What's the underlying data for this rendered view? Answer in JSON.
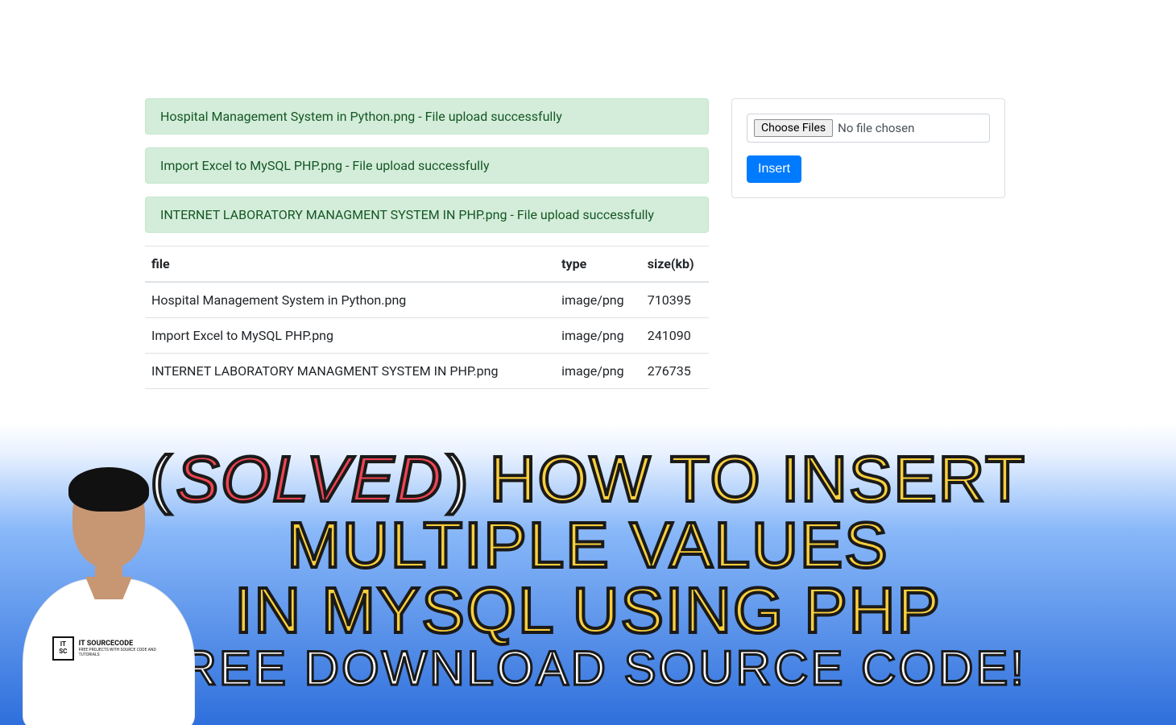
{
  "alerts": [
    "Hospital Management System in Python.png - File upload successfully",
    "Import Excel to MySQL PHP.png - File upload successfully",
    "INTERNET LABORATORY MANAGMENT SYSTEM IN PHP.png - File upload successfully"
  ],
  "table": {
    "headers": {
      "file": "file",
      "type": "type",
      "size": "size(kb)"
    },
    "rows": [
      {
        "file": "Hospital Management System in Python.png",
        "type": "image/png",
        "size": "710395"
      },
      {
        "file": "Import Excel to MySQL PHP.png",
        "type": "image/png",
        "size": "241090"
      },
      {
        "file": "INTERNET LABORATORY MANAGMENT SYSTEM IN PHP.png",
        "type": "image/png",
        "size": "276735"
      }
    ]
  },
  "upload": {
    "choose_label": "Choose Files",
    "status": "No file chosen",
    "submit_label": "Insert"
  },
  "banner": {
    "line1_paren_open": "(",
    "line1_solved": "SOLVED",
    "line1_paren_close": ")",
    "line1_rest": " HOW TO INSERT",
    "line2": "MULTIPLE VALUES",
    "line3": "IN MYSQL USING PHP",
    "line4": "FREE DOWNLOAD SOURCE CODE!"
  },
  "shirt_logo": {
    "box_top": "IT",
    "box_bottom": "SC",
    "main": "IT SOURCECODE",
    "sub": "FREE PROJECTS WITH SOURCE CODE AND TUTORIALS"
  }
}
